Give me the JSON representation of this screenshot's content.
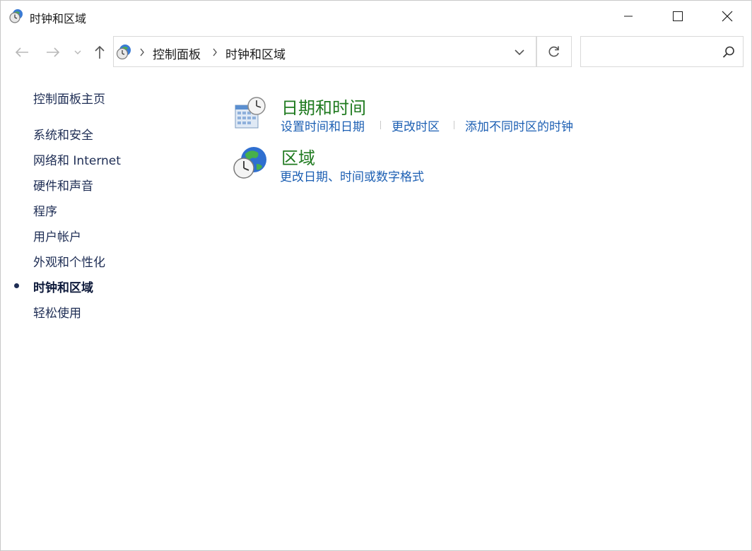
{
  "window": {
    "title": "时钟和区域",
    "icon": "clock-globe-icon"
  },
  "navigation": {
    "back_icon": "back-arrow-icon",
    "forward_icon": "forward-arrow-icon",
    "recent_icon": "chevron-down-icon",
    "up_icon": "up-arrow-icon"
  },
  "address_bar": {
    "breadcrumbs": [
      "控制面板",
      "时钟和区域"
    ],
    "dropdown_icon": "chevron-down-icon",
    "refresh_icon": "refresh-icon"
  },
  "search": {
    "value": "",
    "placeholder": "",
    "icon": "search-icon"
  },
  "sidebar": {
    "home": "控制面板主页",
    "items": [
      {
        "label": "系统和安全",
        "current": false
      },
      {
        "label": "网络和 Internet",
        "current": false
      },
      {
        "label": "硬件和声音",
        "current": false
      },
      {
        "label": "程序",
        "current": false
      },
      {
        "label": "用户帐户",
        "current": false
      },
      {
        "label": "外观和个性化",
        "current": false
      },
      {
        "label": "时钟和区域",
        "current": true
      },
      {
        "label": "轻松使用",
        "current": false
      }
    ]
  },
  "categories": [
    {
      "title": "日期和时间",
      "icon": "calendar-clock-icon",
      "links": [
        "设置时间和日期",
        "更改时区",
        "添加不同时区的时钟"
      ]
    },
    {
      "title": "区域",
      "icon": "globe-clock-icon",
      "links": [
        "更改日期、时间或数字格式"
      ]
    }
  ],
  "colors": {
    "category_title": "#1f7a1f",
    "task_link": "#1c5fb3",
    "sidebar_link": "#1e2d54"
  }
}
